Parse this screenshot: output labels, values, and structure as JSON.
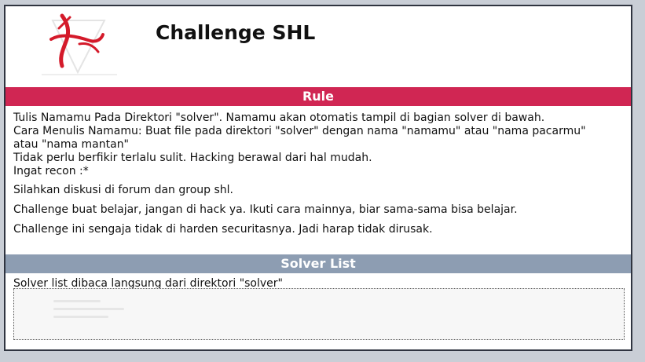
{
  "header": {
    "title": "Challenge SHL"
  },
  "rule_section": {
    "heading": "Rule",
    "lines": [
      "Tulis Namamu Pada Direktori \"solver\". Namamu akan otomatis tampil di bagian solver di bawah.",
      "Cara Menulis Namamu: Buat file pada direktori \"solver\" dengan nama \"namamu\" atau \"nama pacarmu\"",
      "atau \"nama mantan\"",
      "Tidak perlu berfikir terlalu sulit. Hacking berawal dari hal mudah.",
      "Ingat recon :*",
      "Silahkan diskusi di forum dan group shl.",
      "Challenge buat belajar, jangan di hack ya. Ikuti cara mainnya, biar sama-sama bisa belajar.",
      "Challenge ini sengaja tidak di harden securitasnya. Jadi harap tidak dirusak."
    ]
  },
  "solver_section": {
    "heading": "Solver List",
    "description": "Solver list dibaca langsung dari direktori \"solver\""
  },
  "colors": {
    "rule_bar": "#d02653",
    "solver_bar": "#8d9db2",
    "logo_red": "#d41a2a"
  },
  "icons": {
    "logo": "hacker-logo-icon"
  }
}
